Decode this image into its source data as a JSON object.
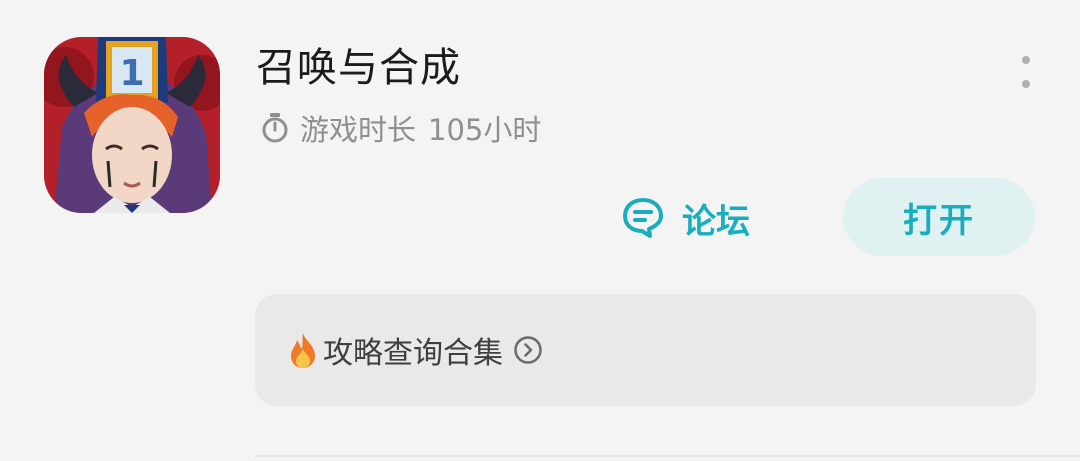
{
  "app": {
    "title": "召唤与合成",
    "icon": "game-app-icon",
    "icon_badge": "1",
    "playtime_label": "游戏时长",
    "playtime_value": "105小时"
  },
  "actions": {
    "forum_label": "论坛",
    "open_label": "打开",
    "more_icon": "more-vertical-icon"
  },
  "guide": {
    "label": "攻略查询合集",
    "prefix_icon": "fire-icon",
    "suffix_icon": "chevron-right-circle-icon"
  },
  "colors": {
    "accent": "#19aebd",
    "open_button_bg": "#dff1f1",
    "guide_bg": "#e9e9e9",
    "title_text": "#1b1b1b",
    "secondary_text": "#8f8f8f"
  }
}
